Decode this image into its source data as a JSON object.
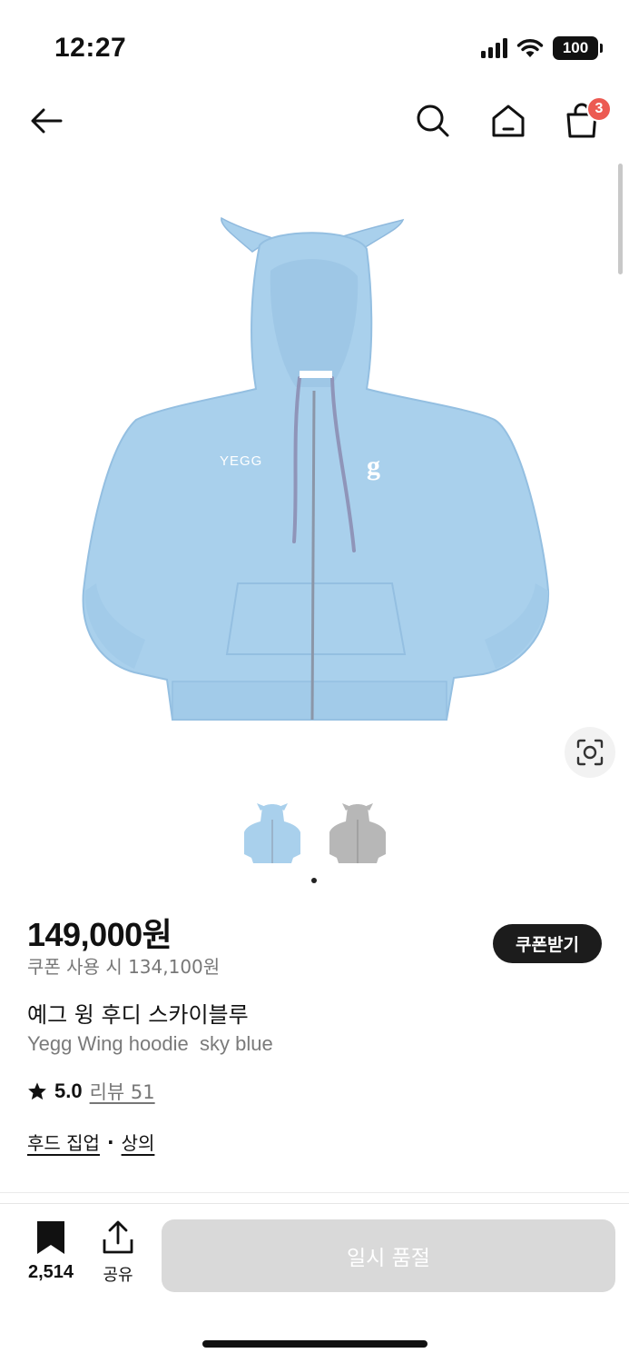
{
  "status_bar": {
    "time": "12:27",
    "battery": "100",
    "icons": [
      "cellular-signal-icon",
      "wifi-icon",
      "battery-icon"
    ]
  },
  "nav": {
    "icons": [
      "arrow-left-icon",
      "search-icon",
      "home-icon",
      "shopping-bag-icon"
    ],
    "cart_count": "3"
  },
  "product": {
    "image_brand_text": "YEGG",
    "image_logo_text": "g",
    "colors": {
      "hoodie_blue": "#a9d0ec",
      "hoodie_gray": "#b7b7b7",
      "drawstring": "#8f95b9"
    },
    "price": "149,000원",
    "coupon_price": "쿠폰 사용 시 134,100원",
    "coupon_button": "쿠폰받기",
    "title_kr": "예그 윙 후디 스카이블루",
    "title_en": "Yegg Wing hoodie  sky blue",
    "rating": "5.0",
    "review_link": "리뷰 51",
    "categories": [
      "후드 집업",
      "상의"
    ],
    "category_separator": "·"
  },
  "bottom_bar": {
    "bookmark_count": "2,514",
    "share_label": "공유",
    "soldout_button": "일시 품절"
  },
  "accent_colors": {
    "badge": "#ec5a52",
    "coupon_button_bg": "#1c1c1c",
    "disabled_button_bg": "#d9d9d9"
  }
}
